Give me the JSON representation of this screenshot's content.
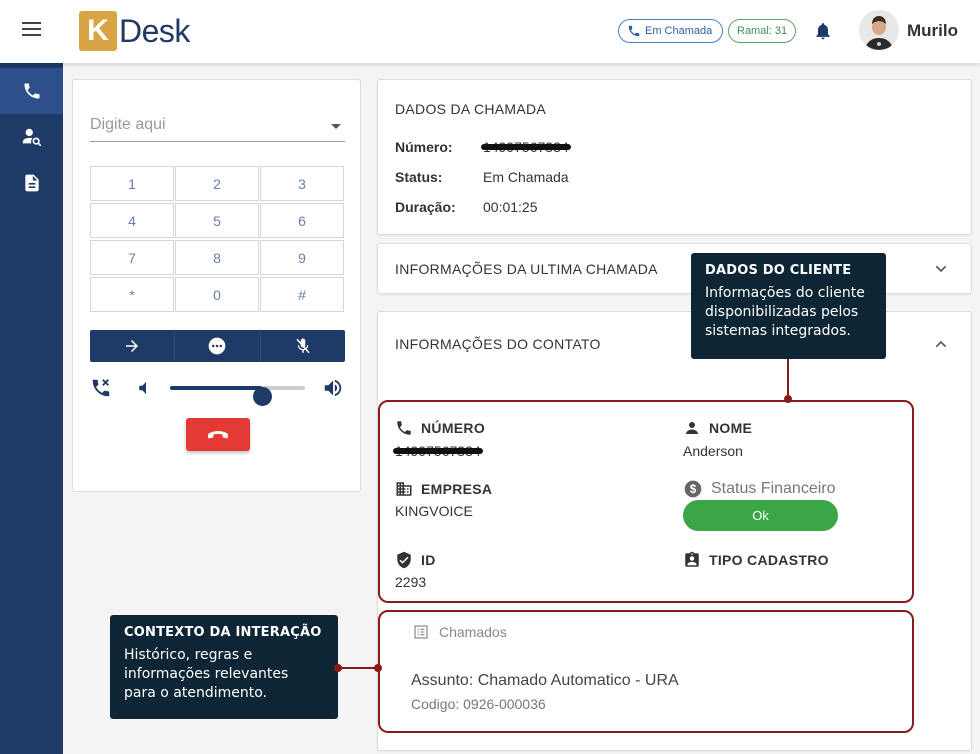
{
  "header": {
    "brand_k": "K",
    "brand_text": "Desk",
    "call_status": "Em Chamada",
    "ramal": "Ramal: 31",
    "user_name": "Murilo"
  },
  "sidebar": {
    "items": [
      {
        "icon": "phone-icon",
        "active": true
      },
      {
        "icon": "contact-search-icon",
        "active": false
      },
      {
        "icon": "document-icon",
        "active": false
      }
    ]
  },
  "dialer": {
    "placeholder": "Digite aqui",
    "keys": [
      "1",
      "2",
      "3",
      "4",
      "5",
      "6",
      "7",
      "8",
      "9",
      "*",
      "0",
      "#"
    ],
    "volume_percent": 68
  },
  "call_info": {
    "title": "DADOS DA CHAMADA",
    "numero_label": "Número:",
    "numero_value": "14997567334",
    "status_label": "Status:",
    "status_value": "Em Chamada",
    "duracao_label": "Duração:",
    "duracao_value": "00:01:25"
  },
  "last_call": {
    "title": "INFORMAÇÕES DA ULTIMA CHAMADA"
  },
  "contact": {
    "title": "INFORMAÇÕES DO CONTATO",
    "numero_label": "NÚMERO",
    "numero_value": "14997567334",
    "nome_label": "NOME",
    "nome_value": "Anderson",
    "empresa_label": "EMPRESA",
    "empresa_value": "KINGVOICE",
    "status_fin_label": "Status Financeiro",
    "status_fin_value": "Ok",
    "id_label": "ID",
    "id_value": "2293",
    "tipo_label": "TIPO CADASTRO"
  },
  "chamados": {
    "title": "Chamados",
    "assunto": "Assunto: Chamado Automatico - URA",
    "codigo": "Codigo: 0926-000036"
  },
  "callouts": {
    "cliente_title": "DADOS DO CLIENTE",
    "cliente_text": "Informações do cliente disponibilizadas pelos sistemas integrados.",
    "contexto_title": "CONTEXTO DA INTERAÇÃO",
    "contexto_text": "Histórico, regras e informações relevantes para o atendimento."
  },
  "colors": {
    "brand_navy": "#1e3a66",
    "brand_gold": "#d9a444",
    "danger": "#e53935",
    "success": "#3aa646",
    "highlight": "#8b1a1a"
  }
}
